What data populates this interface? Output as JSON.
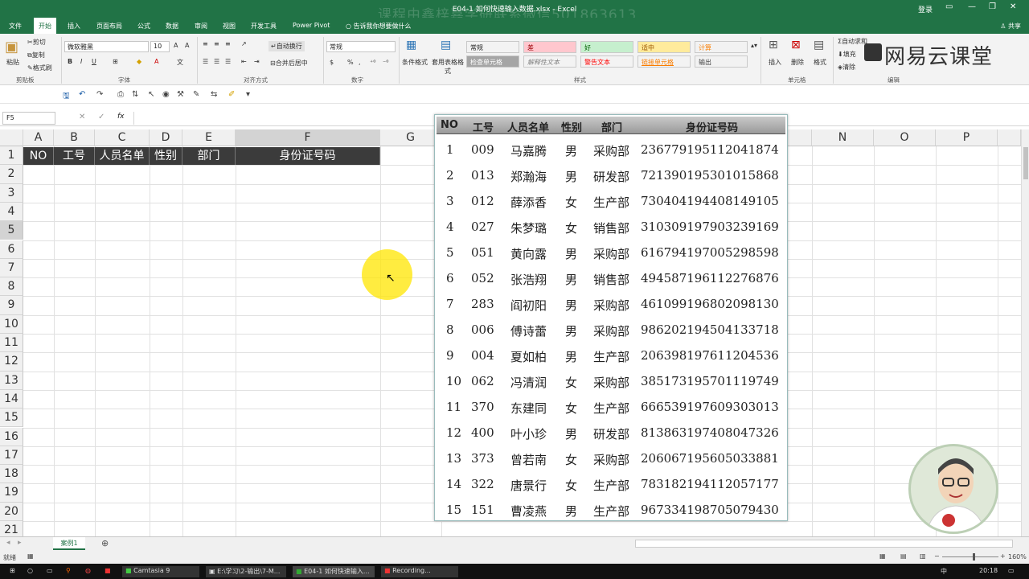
{
  "title": {
    "window": "E04-1 如何快速输入数据.xlsx  -  Excel",
    "watermark": "课程由鑫梓嘉学研联系微信501863613",
    "login": "登录",
    "share": "共享"
  },
  "tabs": [
    "文件",
    "开始",
    "插入",
    "页面布局",
    "公式",
    "数据",
    "审阅",
    "视图",
    "开发工具",
    "Power Pivot"
  ],
  "tellme": "告诉我你想要做什么",
  "ribbon": {
    "clipboard": {
      "paste": "粘贴",
      "cut": "剪切",
      "copy": "复制",
      "format_painter": "格式刷",
      "label": "剪贴板"
    },
    "font": {
      "name": "微软雅黑",
      "size": "10",
      "label": "字体"
    },
    "align": {
      "wrap": "自动换行",
      "merge": "合并后居中",
      "label": "对齐方式"
    },
    "number": {
      "format": "常规",
      "label": "数字"
    },
    "styles": {
      "cond": "条件格式",
      "table": "套用表格格式",
      "cells": [
        {
          "t": "常规",
          "bg": "#ffffff",
          "c": "#000"
        },
        {
          "t": "差",
          "bg": "#ffc7ce",
          "c": "#9c0006"
        },
        {
          "t": "好",
          "bg": "#c6efce",
          "c": "#006100"
        },
        {
          "t": "适中",
          "bg": "#ffeb9c",
          "c": "#9c5700"
        },
        {
          "t": "计算",
          "bg": "#f2f2f2",
          "c": "#fa7d00"
        },
        {
          "t": "检查单元格",
          "bg": "#a5a5a5",
          "c": "#ffffff"
        },
        {
          "t": "解释性文本",
          "bg": "#ffffff",
          "c": "#7f7f7f"
        },
        {
          "t": "警告文本",
          "bg": "#ffffff",
          "c": "#ff0000"
        },
        {
          "t": "链接单元格",
          "bg": "#ffffff",
          "c": "#fa7d00"
        },
        {
          "t": "输出",
          "bg": "#f2f2f2",
          "c": "#3f3f3f"
        }
      ],
      "label": "样式"
    },
    "cells": {
      "insert": "插入",
      "delete": "删除",
      "format": "格式",
      "label": "单元格"
    },
    "edit": {
      "autosum": "自动求和",
      "fill": "填充",
      "clear": "清除",
      "label": "编辑"
    }
  },
  "logo": "网易云课堂",
  "namebox": "F5",
  "fx": "fx",
  "columns": [
    "A",
    "B",
    "C",
    "D",
    "E",
    "F",
    "G",
    "N",
    "O",
    "P"
  ],
  "rows": [
    "1",
    "2",
    "3",
    "4",
    "5",
    "6",
    "7",
    "8",
    "9",
    "10",
    "11",
    "12",
    "13",
    "14",
    "15",
    "16",
    "17",
    "18",
    "19",
    "20",
    "21"
  ],
  "header_row": [
    "NO",
    "工号",
    "人员名单",
    "性别",
    "部门",
    "身份证号码"
  ],
  "image_table": {
    "headers": [
      "NO",
      "工号",
      "人员名单",
      "性别",
      "部门",
      "身份证号码"
    ],
    "rows": [
      [
        "1",
        "009",
        "马嘉腾",
        "男",
        "采购部",
        "236779195112041874"
      ],
      [
        "2",
        "013",
        "郑瀚海",
        "男",
        "研发部",
        "721390195301015868"
      ],
      [
        "3",
        "012",
        "薛添香",
        "女",
        "生产部",
        "730404194408149105"
      ],
      [
        "4",
        "027",
        "朱梦璐",
        "女",
        "销售部",
        "310309197903239169"
      ],
      [
        "5",
        "051",
        "黄向露",
        "男",
        "采购部",
        "616794197005298598"
      ],
      [
        "6",
        "052",
        "张浩翔",
        "男",
        "销售部",
        "494587196112276876"
      ],
      [
        "7",
        "283",
        "阎初阳",
        "男",
        "采购部",
        "461099196802098130"
      ],
      [
        "8",
        "006",
        "傅诗蕾",
        "男",
        "采购部",
        "986202194504133718"
      ],
      [
        "9",
        "004",
        "夏如柏",
        "男",
        "生产部",
        "206398197611204536"
      ],
      [
        "10",
        "062",
        "冯清润",
        "女",
        "采购部",
        "385173195701119749"
      ],
      [
        "11",
        "370",
        "东建同",
        "女",
        "生产部",
        "666539197609303013"
      ],
      [
        "12",
        "400",
        "叶小珍",
        "男",
        "研发部",
        "813863197408047326"
      ],
      [
        "13",
        "373",
        "曾若南",
        "女",
        "采购部",
        "206067195605033881"
      ],
      [
        "14",
        "322",
        "唐景行",
        "女",
        "生产部",
        "783182194112057177"
      ],
      [
        "15",
        "151",
        "曹凌燕",
        "男",
        "生产部",
        "967334198705079430"
      ]
    ]
  },
  "sheet_tab": "案例1",
  "status": {
    "ready": "就绪",
    "zoom": "160%"
  },
  "taskbar": {
    "apps": [
      "Camtasia 9",
      "E:\\学习\\2-输出\\7-M...",
      "E04-1 如何快速输入...",
      "Recording..."
    ],
    "time": "20:18",
    "ime": "中"
  }
}
